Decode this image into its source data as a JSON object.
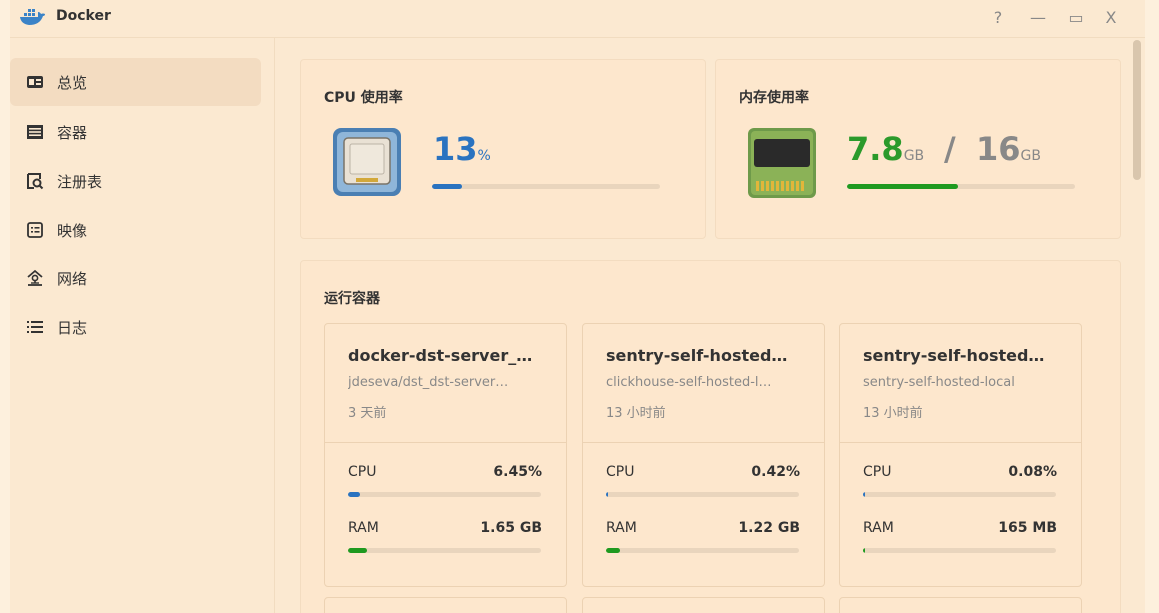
{
  "app": {
    "title": "Docker",
    "help": "?",
    "minimize": "—",
    "maximize": "▭",
    "close": "X"
  },
  "sidebar": {
    "items": [
      {
        "label": "总览",
        "icon": "overview-icon",
        "active": true
      },
      {
        "label": "容器",
        "icon": "container-icon"
      },
      {
        "label": "注册表",
        "icon": "registry-icon"
      },
      {
        "label": "映像",
        "icon": "image-icon"
      },
      {
        "label": "网络",
        "icon": "network-icon"
      },
      {
        "label": "日志",
        "icon": "log-icon"
      }
    ]
  },
  "cpu": {
    "title": "CPU 使用率",
    "value": "13",
    "unit": "%",
    "percent": 13
  },
  "memory": {
    "title": "内存使用率",
    "used": "7.8",
    "used_unit": "GB",
    "sep": "/",
    "total": "16",
    "total_unit": "GB",
    "percent": 48.75
  },
  "running": {
    "title": "运行容器",
    "containers": [
      {
        "name": "docker-dst-server_…",
        "image": "jdeseva/dst_dst-server…",
        "time": "3 天前",
        "cpu_label": "CPU",
        "cpu": "6.45%",
        "cpu_pct": 6.45,
        "ram_label": "RAM",
        "ram": "1.65 GB",
        "ram_pct": 10
      },
      {
        "name": "sentry-self-hosted…",
        "image": "clickhouse-self-hosted-l…",
        "time": "13 小时前",
        "cpu_label": "CPU",
        "cpu": "0.42%",
        "cpu_pct": 0.42,
        "ram_label": "RAM",
        "ram": "1.22 GB",
        "ram_pct": 7.5
      },
      {
        "name": "sentry-self-hosted…",
        "image": "sentry-self-hosted-local",
        "time": "13 小时前",
        "cpu_label": "CPU",
        "cpu": "0.08%",
        "cpu_pct": 0.08,
        "ram_label": "RAM",
        "ram": "165 MB",
        "ram_pct": 1
      }
    ]
  },
  "colors": {
    "cpu_bar": "#2a73c0",
    "ram_bar": "#1f9a20",
    "cpu_text": "#2a73c0",
    "mem_text": "#2b9a2b"
  }
}
